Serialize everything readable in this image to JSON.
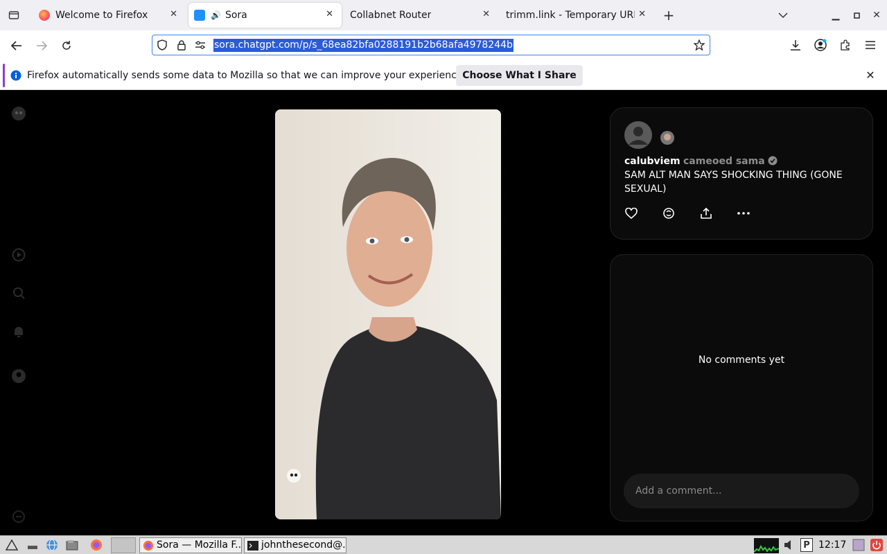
{
  "browser": {
    "tabs": [
      {
        "label": "Welcome to Firefox",
        "active": false
      },
      {
        "label": "Sora",
        "active": true
      },
      {
        "label": "Collabnet Router",
        "active": false
      },
      {
        "label": "trimm.link - Temporary URL",
        "active": false
      }
    ],
    "new_tab_symbol": "+",
    "url": "sora.chatgpt.com/p/s_68ea82bfa0288191b2b68afa4978244b",
    "notification": {
      "text": "Firefox automatically sends some data to Mozilla so that we can improve your experience.",
      "button_label": "Choose What I Share"
    }
  },
  "post": {
    "username": "calubviem",
    "cameo_text": "cameoed sama",
    "caption": "SAM ALT MAN SAYS SHOCKING THING (GONE SEXUAL)",
    "actions": [
      "heart-icon",
      "remix-icon",
      "share-icon",
      "more-icon"
    ]
  },
  "comments": {
    "empty_text": "No comments yet",
    "input_placeholder": "Add a comment..."
  },
  "taskbar": {
    "windows": [
      {
        "label": "Sora — Mozilla F..."
      },
      {
        "label": "johnthesecond@..."
      }
    ],
    "clock": "12:17"
  },
  "colors": {
    "accent": "#2c5bd8",
    "page_background": "#000000",
    "card_background": "#0b0b0b"
  }
}
